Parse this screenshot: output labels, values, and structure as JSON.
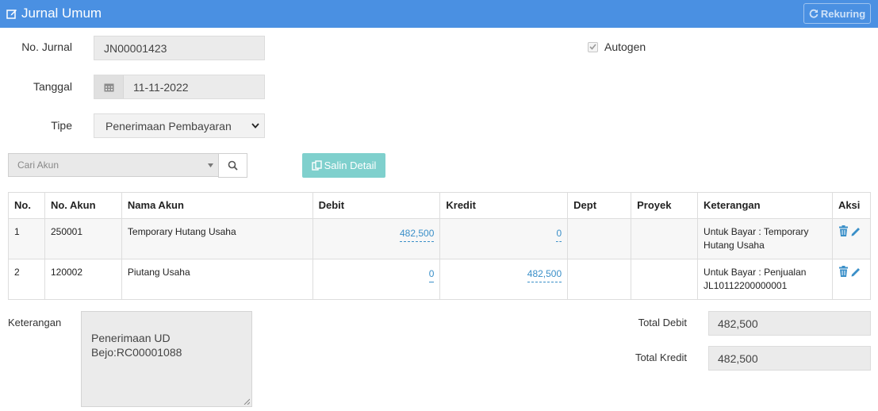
{
  "header": {
    "title": "Jurnal Umum",
    "rekuring_label": "Rekuring"
  },
  "form": {
    "no_jurnal_label": "No. Jurnal",
    "no_jurnal_value": "JN00001423",
    "tanggal_label": "Tanggal",
    "tanggal_value": "11-11-2022",
    "tipe_label": "Tipe",
    "tipe_value": "Penerimaan Pembayaran",
    "autogen_label": "Autogen",
    "autogen_checked": true
  },
  "toolbar": {
    "cari_placeholder": "Cari Akun",
    "salin_label": "Salin Detail"
  },
  "table": {
    "headers": [
      "No.",
      "No. Akun",
      "Nama Akun",
      "Debit",
      "Kredit",
      "Dept",
      "Proyek",
      "Keterangan",
      "Aksi"
    ],
    "rows": [
      {
        "no": "1",
        "no_akun": "250001",
        "nama_akun": "Temporary Hutang Usaha",
        "debit": "482,500",
        "kredit": "0",
        "dept": "",
        "proyek": "",
        "keterangan": "Untuk Bayar : Temporary Hutang Usaha"
      },
      {
        "no": "2",
        "no_akun": "120002",
        "nama_akun": "Piutang Usaha",
        "debit": "0",
        "kredit": "482,500",
        "dept": "",
        "proyek": "",
        "keterangan": "Untuk Bayar : Penjualan JL10112200000001"
      }
    ]
  },
  "footer": {
    "keterangan_label": "Keterangan",
    "keterangan_value": "Penerimaan UD\nBejo:RC00001088",
    "total_debit_label": "Total Debit",
    "total_debit_value": "482,500",
    "total_kredit_label": "Total Kredit",
    "total_kredit_value": "482,500"
  },
  "colors": {
    "header_bg": "#4a90e2",
    "salin_bg": "#7fd0cd",
    "link_blue": "#3a8fc8",
    "table_border": "#3a9bd0"
  }
}
